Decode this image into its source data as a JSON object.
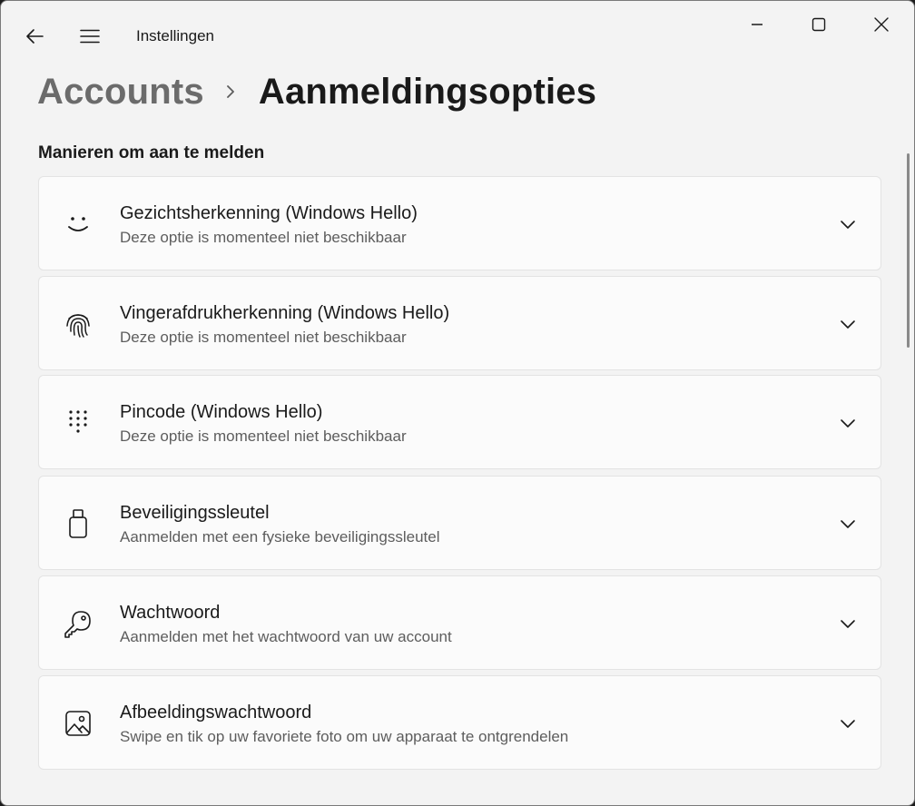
{
  "window": {
    "title": "Instellingen"
  },
  "breadcrumb": {
    "parent": "Accounts",
    "current": "Aanmeldingsopties"
  },
  "section": {
    "title": "Manieren om aan te melden"
  },
  "options": [
    {
      "title": "Gezichtsherkenning (Windows Hello)",
      "description": "Deze optie is momenteel niet beschikbaar",
      "icon": "face-icon"
    },
    {
      "title": "Vingerafdrukherkenning (Windows Hello)",
      "description": "Deze optie is momenteel niet beschikbaar",
      "icon": "fingerprint-icon"
    },
    {
      "title": "Pincode (Windows Hello)",
      "description": "Deze optie is momenteel niet beschikbaar",
      "icon": "pin-keypad-icon"
    },
    {
      "title": "Beveiligingssleutel",
      "description": "Aanmelden met een fysieke beveiligingssleutel",
      "icon": "usb-key-icon"
    },
    {
      "title": "Wachtwoord",
      "description": "Aanmelden met het wachtwoord van uw account",
      "icon": "key-icon"
    },
    {
      "title": "Afbeeldingswachtwoord",
      "description": "Swipe en tik op uw favoriete foto om uw apparaat te ontgrendelen",
      "icon": "picture-icon"
    }
  ]
}
